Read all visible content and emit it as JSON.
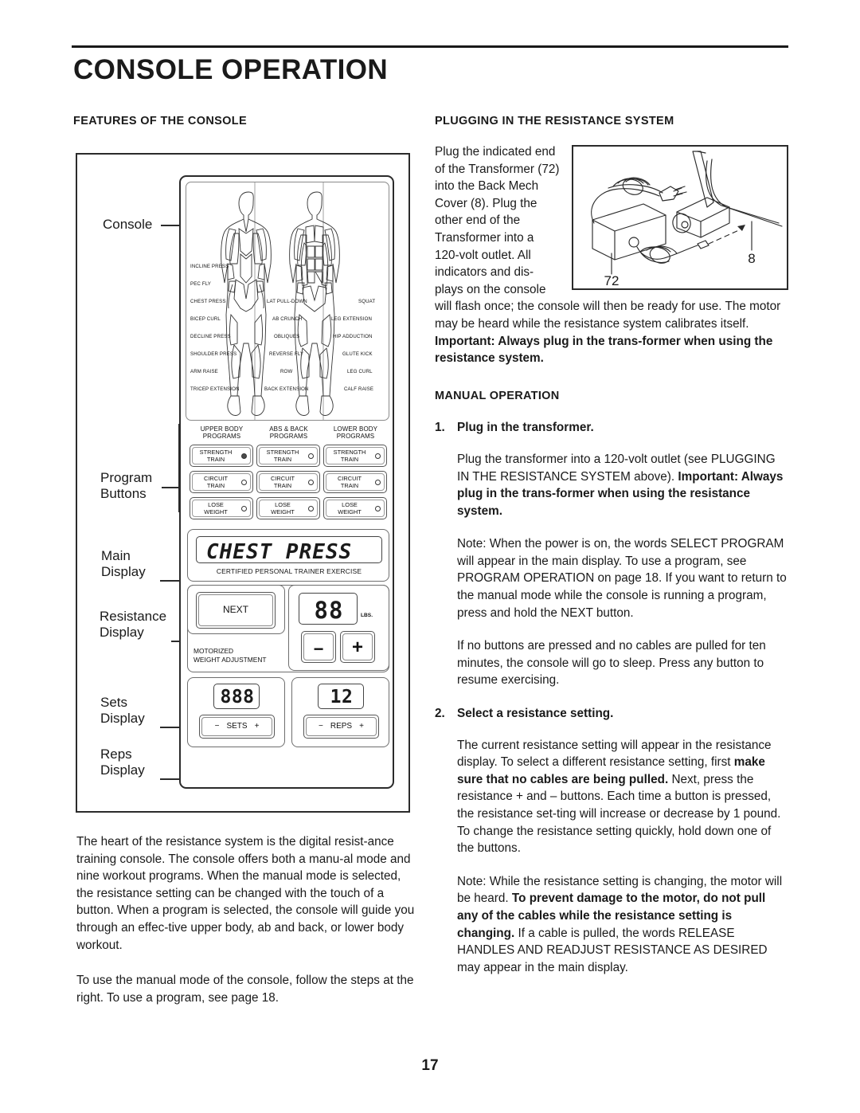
{
  "page": {
    "title": "CONSOLE OPERATION",
    "number": "17"
  },
  "sections": {
    "features_heading": "FEATURES OF THE CONSOLE",
    "plugging_heading": "PLUGGING IN THE RESISTANCE SYSTEM",
    "manual_heading": "MANUAL OPERATION"
  },
  "console_diagram": {
    "callouts": [
      {
        "id": "console",
        "line1": "Console",
        "line2": ""
      },
      {
        "id": "program-buttons",
        "line1": "Program",
        "line2": "Buttons"
      },
      {
        "id": "main-display",
        "line1": "Main",
        "line2": "Display"
      },
      {
        "id": "resistance-display",
        "line1": "Resistance",
        "line2": "Display"
      },
      {
        "id": "sets-display",
        "line1": "Sets",
        "line2": "Display"
      },
      {
        "id": "reps-display",
        "line1": "Reps",
        "line2": "Display"
      }
    ],
    "exercises_left": [
      "INCLINE PRESS",
      "PEC FLY",
      "CHEST PRESS",
      "BICEP CURL",
      "DECLINE PRESS",
      "SHOULDER PRESS",
      "ARM RAISE",
      "TRICEP EXTENSION"
    ],
    "exercises_middle": [
      "LAT PULL-DOWN",
      "AB CRUNCH",
      "OBLIQUES",
      "REVERSE FLY",
      "ROW",
      "BACK EXTENSION"
    ],
    "exercises_right": [
      "SQUAT",
      "LEG EXTENSION",
      "HIP ADDUCTION",
      "GLUTE KICK",
      "LEG CURL",
      "CALF RAISE"
    ],
    "program_groups": [
      {
        "title_line1": "UPPER BODY",
        "title_line2": "PROGRAMS",
        "buttons": [
          {
            "line1": "STRENGTH",
            "line2": "TRAIN",
            "led": "on"
          },
          {
            "line1": "CIRCUIT",
            "line2": "TRAIN",
            "led": "off"
          },
          {
            "line1": "LOSE",
            "line2": "WEIGHT",
            "led": "off"
          }
        ]
      },
      {
        "title_line1": "ABS & BACK",
        "title_line2": "PROGRAMS",
        "buttons": [
          {
            "line1": "STRENGTH",
            "line2": "TRAIN",
            "led": "off"
          },
          {
            "line1": "CIRCUIT",
            "line2": "TRAIN",
            "led": "off"
          },
          {
            "line1": "LOSE",
            "line2": "WEIGHT",
            "led": "off"
          }
        ]
      },
      {
        "title_line1": "LOWER BODY",
        "title_line2": "PROGRAMS",
        "buttons": [
          {
            "line1": "STRENGTH",
            "line2": "TRAIN",
            "led": "off"
          },
          {
            "line1": "CIRCUIT",
            "line2": "TRAIN",
            "led": "off"
          },
          {
            "line1": "LOSE",
            "line2": "WEIGHT",
            "led": "off"
          }
        ]
      }
    ],
    "main_display_value": "CHEST PRESS",
    "main_display_caption": "CERTIFIED PERSONAL TRAINER EXERCISE",
    "next_button": "NEXT",
    "resistance_value": "88",
    "resistance_units": "LBS.",
    "motorized_caption_line1": "MOTORIZED",
    "motorized_caption_line2": "WEIGHT ADJUSTMENT",
    "minus_button": "−",
    "plus_button": "+",
    "sets_value": "888",
    "sets_minus": "−",
    "sets_label": "SETS",
    "sets_plus": "+",
    "reps_value": "12",
    "reps_minus": "−",
    "reps_label": "REPS",
    "reps_plus": "+"
  },
  "transformer_figure": {
    "label_transformer": "72",
    "label_cover": "8"
  },
  "left_text": {
    "para1": "The heart of the resistance system is the digital resist-ance training console. The console offers both a manu-al mode and nine workout programs. When the manual mode is selected, the resistance setting can be changed with the touch of a button. When a program is selected, the console will guide you through an effec-tive upper body, ab and back, or lower body workout.",
    "para2": "To use the manual mode of the console, follow the steps at the right. To use a program, see page 18."
  },
  "right_text": {
    "plugging_para_a": "Plug the indicated end of the Transformer (72) into the Back Mech Cover (8). Plug the other end of the Transformer into a 120-volt outlet. All indicators and dis-plays on the console will flash once; the console will then be ready for use. The motor may be heard while the resistance system calibrates itself. ",
    "plugging_para_a_bold": "Important: Always plug in the trans-former when using the resistance system.",
    "step1_num": "1.",
    "step1_title": "Plug in the transformer.",
    "step1_body_a": "Plug the transformer into a 120-volt outlet (see PLUGGING IN THE RESISTANCE SYSTEM above). ",
    "step1_body_bold": "Important: Always plug in the trans-former when using the resistance system.",
    "step1_note": "Note: When the power is on, the words SELECT PROGRAM will appear in the main display. To use a program, see PROGRAM OPERATION on page 18. If you want to return to the manual mode while the console is running a program, press and hold the NEXT button.",
    "step1_sleep": "If no buttons are pressed and no cables are pulled for ten minutes, the console will go to sleep. Press any button to resume exercising.",
    "step2_num": "2.",
    "step2_title": "Select a resistance setting.",
    "step2_body_a": "The current resistance setting will appear in the resistance display. To select a different resistance setting, first ",
    "step2_body_bold1": "make sure that no cables are being pulled.",
    "step2_body_b": " Next, press the resistance + and – buttons. Each time a button is pressed, the resistance set-ting will increase or decrease by 1 pound. To change the resistance setting quickly, hold down one of the buttons.",
    "step2_note_a": "Note: While the resistance setting is changing, the motor will be heard. ",
    "step2_note_bold": "To prevent damage to the motor, do not pull any of the cables while the resistance setting is changing.",
    "step2_note_b": " If a cable is pulled, the words RELEASE HANDLES AND READJUST RESISTANCE AS DESIRED may appear in the main display."
  }
}
